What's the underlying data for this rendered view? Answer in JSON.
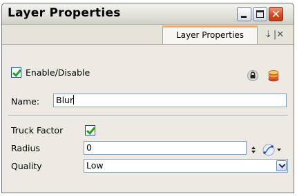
{
  "window": {
    "title": "Layer Properties",
    "minimize_label": "",
    "maximize_label": "",
    "close_label": "✕"
  },
  "tabs": [
    {
      "label": "Layer Properties",
      "active": true
    }
  ],
  "tab_tools": {
    "pin_glyph": "⇣",
    "close_glyph": "|✕"
  },
  "enable": {
    "label": "Enable/Disable",
    "checked": true
  },
  "name": {
    "label": "Name:",
    "value": "Blur"
  },
  "truck_factor": {
    "label": "Truck Factor",
    "checked": true
  },
  "radius": {
    "label": "Radius",
    "value": "0"
  },
  "quality": {
    "label": "Quality",
    "selected": "Low"
  },
  "icons": {
    "lock": "lock-icon",
    "layer": "layer-stack-icon",
    "curve": "function-curve-icon",
    "spinner": "spinner-arrows-icon"
  },
  "colors": {
    "tab_accent": "#f3b24a",
    "checkmark": "#21a121",
    "close_button": "#d9491f",
    "panel_bg": "#eceae2"
  }
}
